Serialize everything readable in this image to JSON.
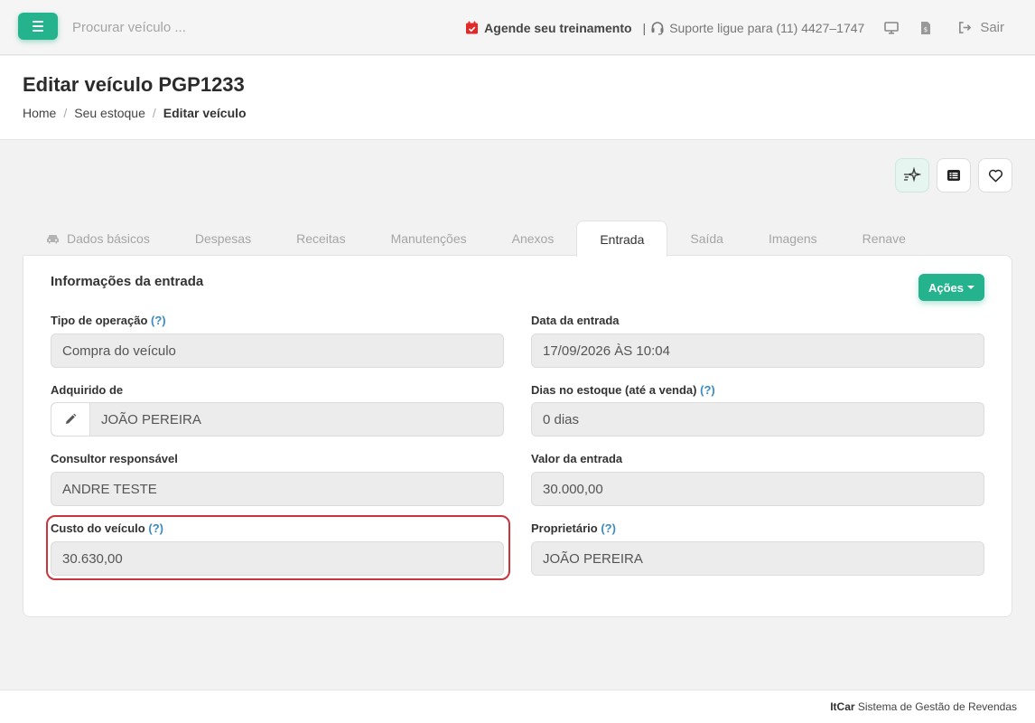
{
  "topbar": {
    "search_placeholder": "Procurar veículo ...",
    "training_label": "Agende seu treinamento",
    "separator": "|",
    "support_label": "Suporte ligue para (11) 4427–1747",
    "logout_label": "Sair"
  },
  "header": {
    "title": "Editar veículo PGP1233",
    "breadcrumb": [
      "Home",
      "Seu estoque",
      "Editar veículo"
    ],
    "breadcrumb_separator": "/"
  },
  "tabs": [
    {
      "label": "Dados básicos",
      "icon": "car-icon"
    },
    {
      "label": "Despesas"
    },
    {
      "label": "Receitas"
    },
    {
      "label": "Manutenções"
    },
    {
      "label": "Anexos"
    },
    {
      "label": "Entrada",
      "active": true
    },
    {
      "label": "Saída"
    },
    {
      "label": "Imagens"
    },
    {
      "label": "Renave"
    }
  ],
  "section": {
    "title": "Informações da entrada",
    "actions_label": "Ações"
  },
  "fields": {
    "tipo_operacao": {
      "label": "Tipo de operação",
      "help": "(?)",
      "value": "Compra do veículo"
    },
    "data_entrada": {
      "label": "Data da entrada",
      "value": "17/09/2026 ÀS 10:04"
    },
    "adquirido_de": {
      "label": "Adquirido de",
      "value": "JOÃO PEREIRA"
    },
    "dias_estoque": {
      "label": "Dias no estoque (até a venda)",
      "help": "(?)",
      "value": "0 dias"
    },
    "consultor": {
      "label": "Consultor responsável",
      "value": "ANDRE TESTE"
    },
    "valor_entrada": {
      "label": "Valor da entrada",
      "value": "30.000,00"
    },
    "custo_veiculo": {
      "label": "Custo do veículo",
      "help": "(?)",
      "value": "30.630,00"
    },
    "proprietario": {
      "label": "Proprietário",
      "help": "(?)",
      "value": "JOÃO PEREIRA"
    }
  },
  "footer": {
    "brand": "ItCar",
    "text": "Sistema de Gestão de Revendas"
  },
  "colors": {
    "accent": "#25b38e",
    "help": "#3a8bbf",
    "highlight": "#c9353f",
    "calendar": "#e02a2a"
  }
}
